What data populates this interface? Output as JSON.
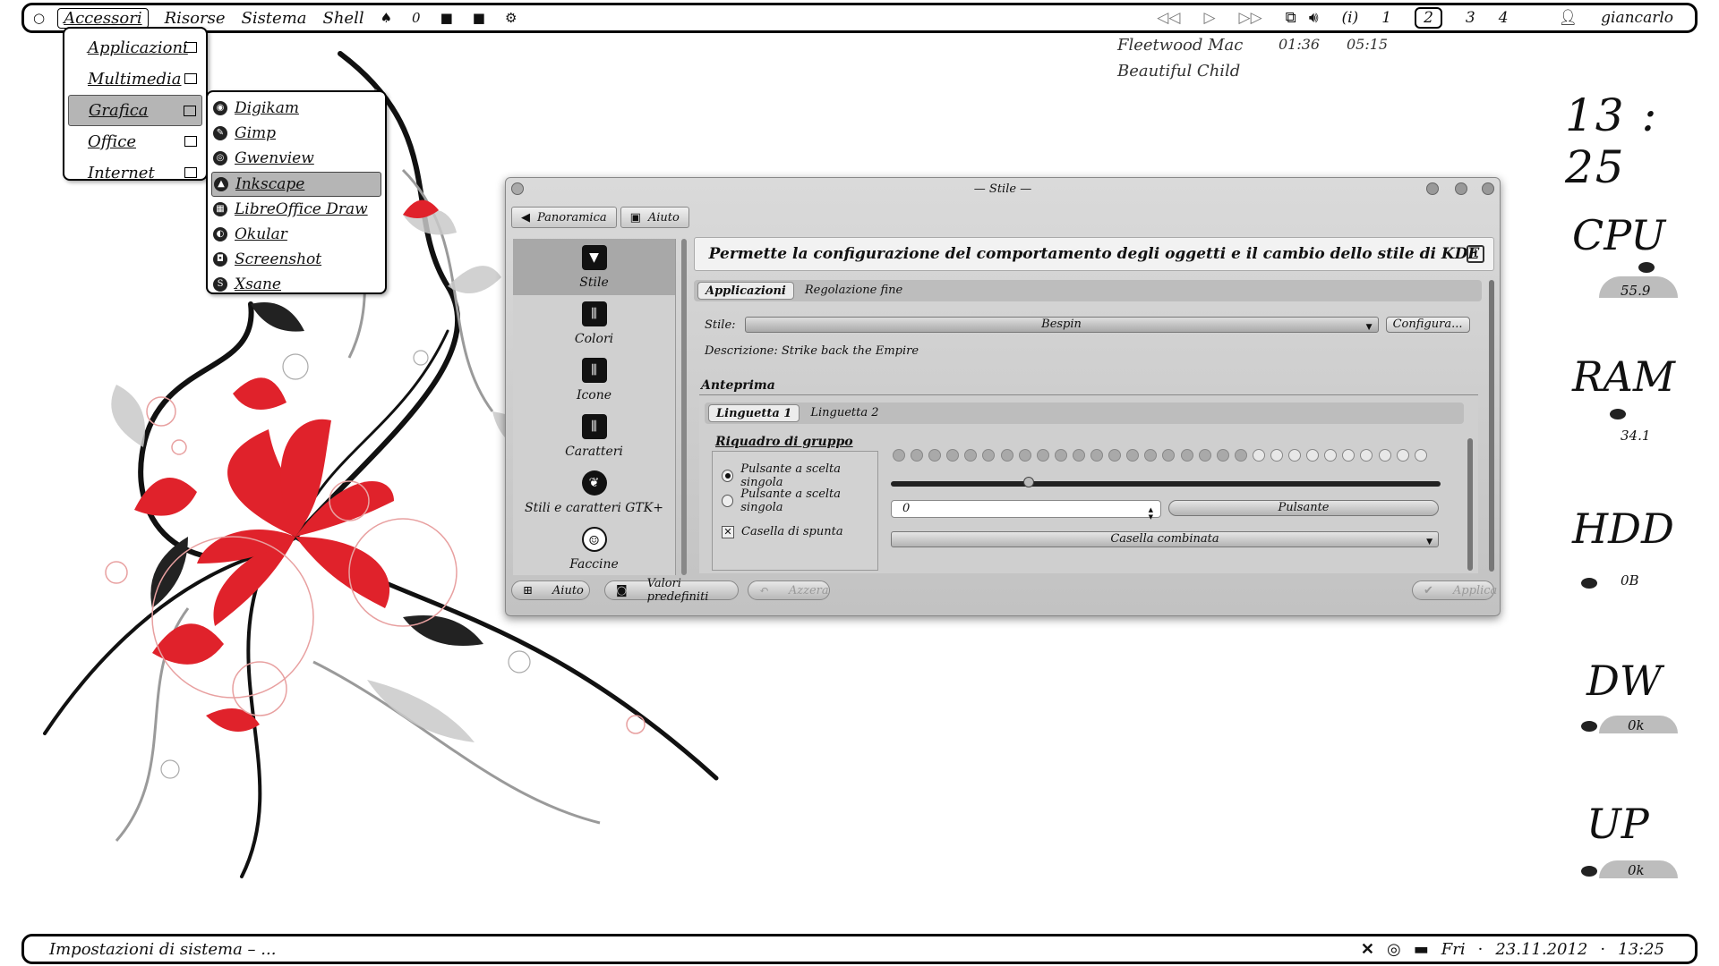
{
  "top_panel": {
    "menu": [
      "Accessori",
      "Risorse",
      "Sistema",
      "Shell"
    ],
    "counter": "0",
    "desktops": [
      "1",
      "2",
      "3",
      "4"
    ],
    "info_label": "(i)",
    "user": "giancarlo"
  },
  "accessori_menu": {
    "items": [
      {
        "label": "Applicazioni"
      },
      {
        "label": "Multimedia"
      },
      {
        "label": "Grafica"
      },
      {
        "label": "Office"
      },
      {
        "label": "Internet"
      }
    ]
  },
  "grafica_submenu": {
    "items": [
      "Digikam",
      "Gimp",
      "Gwenview",
      "Inkscape",
      "LibreOffice Draw",
      "Okular",
      "Screenshot",
      "Xsane"
    ]
  },
  "now_playing": {
    "artist": "Fleetwood Mac",
    "title": "Beautiful Child",
    "elapsed": "01:36",
    "total": "05:15"
  },
  "widgets": {
    "clock": "13 : 25",
    "cpu_label": "CPU",
    "cpu_value": "55.9",
    "ram_label": "RAM",
    "ram_value": "34.1",
    "hdd_label": "HDD",
    "hdd_value": "0B",
    "dw_label": "DW",
    "dw_value": "0k",
    "up_label": "UP",
    "up_value": "0k"
  },
  "window": {
    "title": "Stile",
    "toolbar": {
      "overview": "Panoramica",
      "help": "Aiuto"
    },
    "sidebar": [
      "Stile",
      "Colori",
      "Icone",
      "Caratteri",
      "Stili e caratteri GTK+",
      "Faccine"
    ],
    "header": "Permette la configurazione del comportamento degli oggetti e il cambio dello stile di KDE",
    "tabs": [
      "Applicazioni",
      "Regolazione fine"
    ],
    "style_label": "Stile:",
    "style_value": "Bespin",
    "configure_label": "Configura...",
    "description": "Descrizione: Strike back the Empire",
    "preview_label": "Anteprima",
    "preview_tabs": [
      "Linguetta 1",
      "Linguetta 2"
    ],
    "groupbox_label": "Riquadro di gruppo",
    "radio1": "Pulsante a scelta singola",
    "radio2": "Pulsante a scelta singola",
    "checkbox": "Casella di spunta",
    "spin_value": "0",
    "button_label": "Pulsante",
    "combo_label": "Casella combinata",
    "progress_fraction": 0.68,
    "slider_fraction": 0.25,
    "bottom": {
      "help": "Aiuto",
      "defaults": "Valori predefiniti",
      "reset": "Azzera",
      "apply": "Applica"
    }
  },
  "bottom_panel": {
    "task": "Impostazioni di sistema – ...",
    "day": "Fri",
    "date": "23.11.2012",
    "time": "13:25"
  },
  "colors": {
    "accent_red": "#e0222b",
    "window_bg": "#cfcfcf"
  }
}
